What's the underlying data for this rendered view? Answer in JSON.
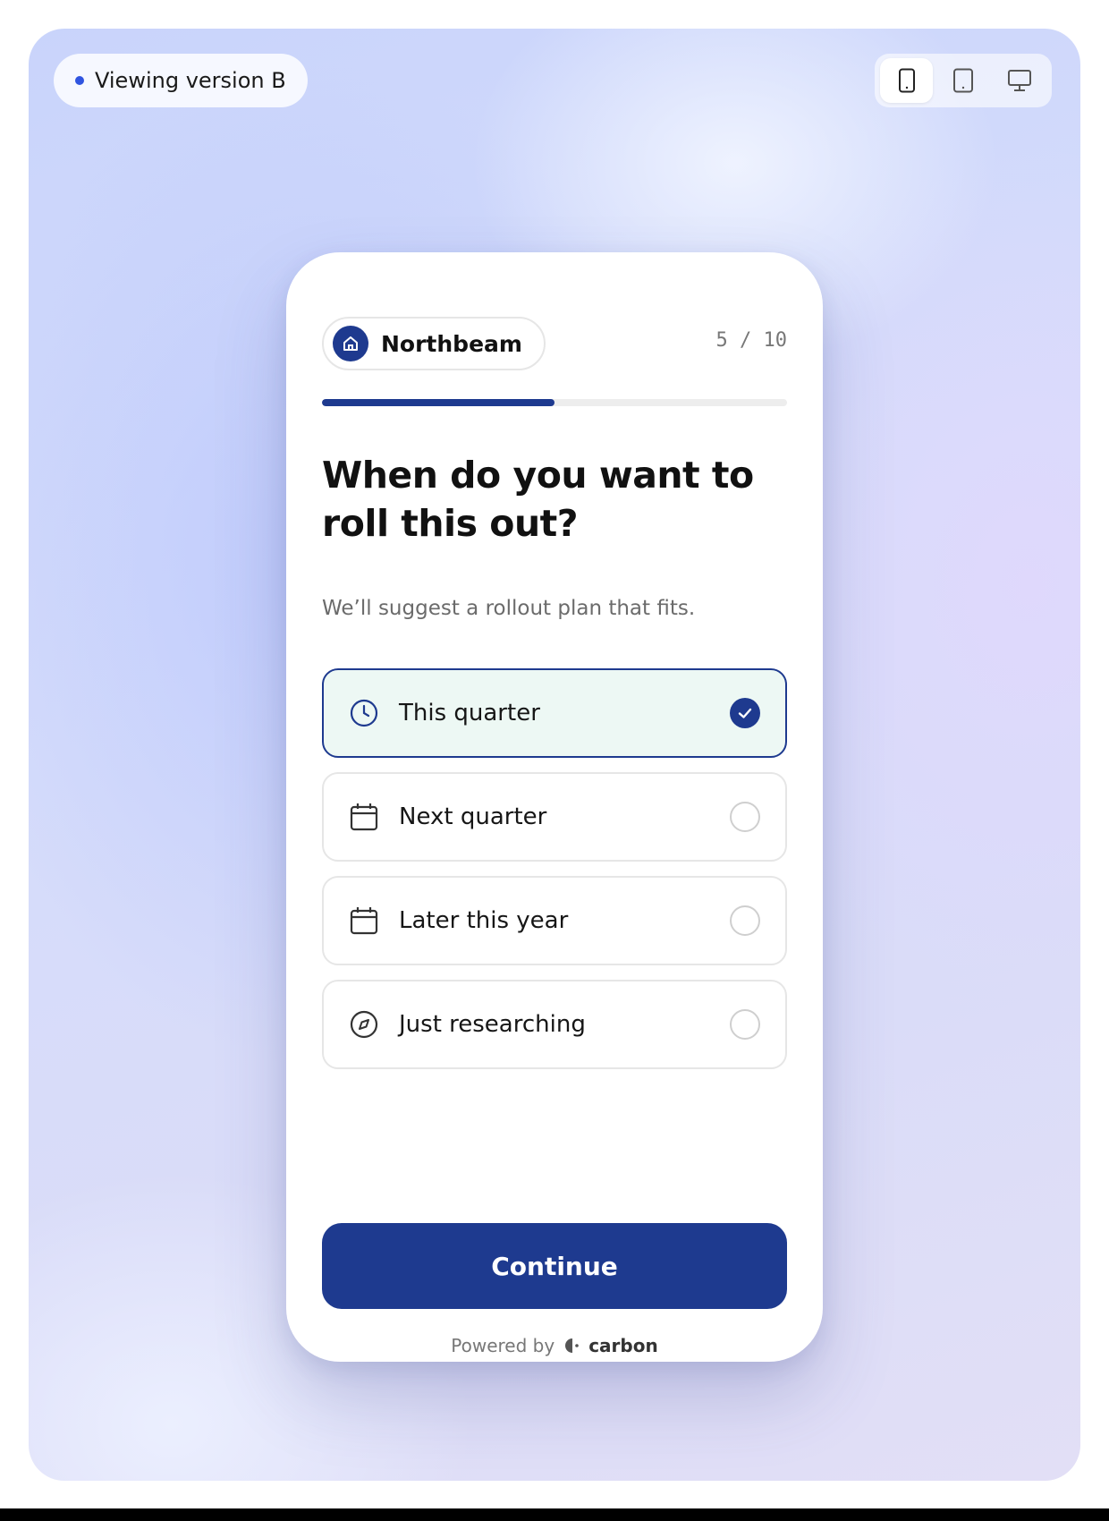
{
  "banner": {
    "version_label": "Viewing version B"
  },
  "device_switcher": {
    "options": [
      "mobile",
      "tablet",
      "desktop"
    ],
    "selected": "mobile"
  },
  "card": {
    "brand_name": "Northbeam",
    "step": "5 / 10",
    "progress": 0.5,
    "question": "When do you want to roll this out?",
    "subtitle": "We’ll suggest a rollout plan that fits.",
    "options": [
      {
        "label": "This quarter",
        "icon": "clock-icon",
        "selected": true
      },
      {
        "label": "Next quarter",
        "icon": "calendar-icon",
        "selected": false
      },
      {
        "label": "Later this year",
        "icon": "calendar-icon",
        "selected": false
      },
      {
        "label": "Just researching",
        "icon": "compass-icon",
        "selected": false
      }
    ],
    "continue_label": "Continue",
    "powered_by_label": "Powered by",
    "powered_by_brand": "carbon"
  },
  "colors": {
    "primary": "#1e3a8f",
    "selected_bg": "#edf8f4",
    "dot": "#2f54e0"
  }
}
